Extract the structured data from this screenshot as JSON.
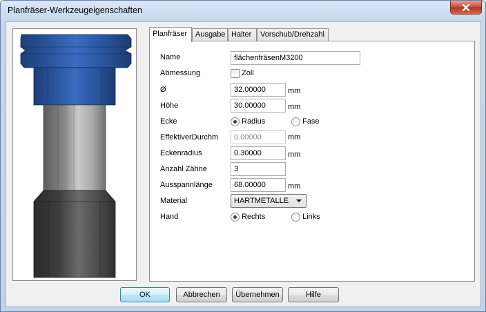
{
  "window": {
    "title": "Planfräser-Werkzeugeigenschaften"
  },
  "tabs": [
    {
      "label": "Planfräser"
    },
    {
      "label": "Ausgabe"
    },
    {
      "label": "Halter"
    },
    {
      "label": "Vorschub/Drehzahl"
    }
  ],
  "form": {
    "name_label": "Name",
    "name_value": "flächenfräsenM3200",
    "abmessung_label": "Abmessung",
    "zoll_label": "Zoll",
    "diameter_label": "Ø",
    "diameter_value": "32.00000",
    "diameter_unit": "mm",
    "hoehe_label": "Höhe",
    "hoehe_value": "30.00000",
    "hoehe_unit": "mm",
    "ecke_label": "Ecke",
    "radius_label": "Radius",
    "fase_label": "Fase",
    "eff_label": "EffektiverDurchm",
    "eff_value": "0.00000",
    "eff_unit": "mm",
    "eckenradius_label": "Eckenradius",
    "eckenradius_value": "0.30000",
    "eckenradius_unit": "mm",
    "zaehne_label": "Anzahl Zähne",
    "zaehne_value": "3",
    "ausspann_label": "Ausspannlänge",
    "ausspann_value": "68.00000",
    "ausspann_unit": "mm",
    "material_label": "Material",
    "material_value": "HARTMETALLE",
    "hand_label": "Hand",
    "rechts_label": "Rechts",
    "links_label": "Links"
  },
  "buttons": {
    "ok": "OK",
    "abbrechen": "Abbrechen",
    "uebernehmen": "Übernehmen",
    "hilfe": "Hilfe"
  },
  "colors": {
    "holder_blue": "#2d5aa0",
    "shank_gray": "#9a9a9a",
    "cutter_dark": "#3a3a3a"
  }
}
